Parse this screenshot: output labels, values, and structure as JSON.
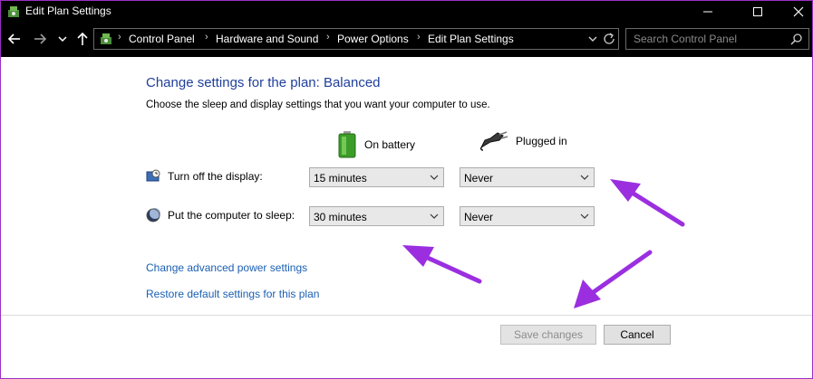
{
  "window": {
    "title": "Edit Plan Settings",
    "controls": [
      "minimize",
      "maximize",
      "close"
    ]
  },
  "address_bar": {
    "breadcrumbs": [
      "Control Panel",
      "Hardware and Sound",
      "Power Options",
      "Edit Plan Settings"
    ],
    "search_placeholder": "Search Control Panel"
  },
  "main": {
    "heading": "Change settings for the plan: Balanced",
    "subheading": "Choose the sleep and display settings that you want your computer to use.",
    "columns": {
      "battery_label": "On battery",
      "plugged_label": "Plugged in"
    },
    "rows": [
      {
        "label": "Turn off the display:",
        "battery_value": "15 minutes",
        "plugged_value": "Never"
      },
      {
        "label": "Put the computer to sleep:",
        "battery_value": "30 minutes",
        "plugged_value": "Never"
      }
    ],
    "links": {
      "advanced": "Change advanced power settings",
      "restore": "Restore default settings for this plan"
    },
    "buttons": {
      "save": "Save changes",
      "cancel": "Cancel",
      "save_disabled": true
    }
  },
  "colors": {
    "heading": "#1f3f9a",
    "link": "#1a5fb4",
    "annotation_arrow": "#9b2fe0"
  },
  "icons": [
    "control-panel-icon",
    "back-arrow-icon",
    "forward-arrow-icon",
    "chevron-down-icon",
    "up-arrow-icon",
    "refresh-icon",
    "search-icon",
    "battery-icon",
    "power-plug-icon",
    "monitor-clock-icon",
    "moon-icon"
  ]
}
